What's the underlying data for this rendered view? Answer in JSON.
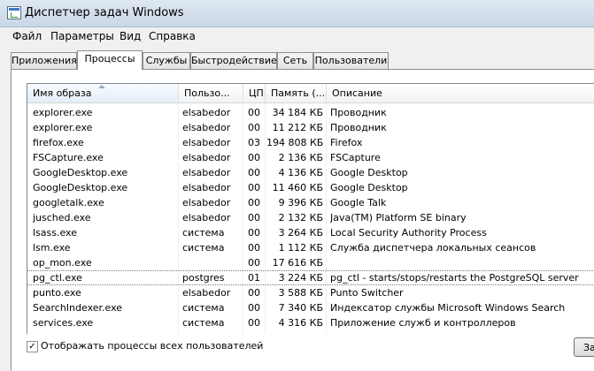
{
  "window": {
    "title": "Диспетчер задач Windows"
  },
  "menu": [
    "Файл",
    "Параметры",
    "Вид",
    "Справка"
  ],
  "tabs": [
    {
      "label": "Приложения",
      "active": false
    },
    {
      "label": "Процессы",
      "active": true
    },
    {
      "label": "Службы",
      "active": false
    },
    {
      "label": "Быстродействие",
      "active": false
    },
    {
      "label": "Сеть",
      "active": false
    },
    {
      "label": "Пользователи",
      "active": false
    }
  ],
  "columns": {
    "name": "Имя образа",
    "user": "Пользо...",
    "cpu": "ЦП",
    "mem": "Память (...",
    "desc": "Описание"
  },
  "processes": [
    {
      "name": "explorer.exe",
      "user": "elsabedor",
      "cpu": "00",
      "mem": "34 184 КБ",
      "desc": "Проводник"
    },
    {
      "name": "explorer.exe",
      "user": "elsabedor",
      "cpu": "00",
      "mem": "11 212 КБ",
      "desc": "Проводник"
    },
    {
      "name": "firefox.exe",
      "user": "elsabedor",
      "cpu": "03",
      "mem": "194 808 КБ",
      "desc": "Firefox"
    },
    {
      "name": "FSCapture.exe",
      "user": "elsabedor",
      "cpu": "00",
      "mem": "2 136 КБ",
      "desc": "FSCapture"
    },
    {
      "name": "GoogleDesktop.exe",
      "user": "elsabedor",
      "cpu": "00",
      "mem": "4 136 КБ",
      "desc": "Google Desktop"
    },
    {
      "name": "GoogleDesktop.exe",
      "user": "elsabedor",
      "cpu": "00",
      "mem": "11 460 КБ",
      "desc": "Google Desktop"
    },
    {
      "name": "googletalk.exe",
      "user": "elsabedor",
      "cpu": "00",
      "mem": "9 396 КБ",
      "desc": "Google Talk"
    },
    {
      "name": "jusched.exe",
      "user": "elsabedor",
      "cpu": "00",
      "mem": "2 132 КБ",
      "desc": "Java(TM) Platform SE binary"
    },
    {
      "name": "lsass.exe",
      "user": "система",
      "cpu": "00",
      "mem": "3 264 КБ",
      "desc": "Local Security Authority Process"
    },
    {
      "name": "lsm.exe",
      "user": "система",
      "cpu": "00",
      "mem": "1 112 КБ",
      "desc": "Служба диспетчера локальных сеансов"
    },
    {
      "name": "op_mon.exe",
      "user": "",
      "cpu": "00",
      "mem": "17 616 КБ",
      "desc": ""
    },
    {
      "name": "pg_ctl.exe",
      "user": "postgres",
      "cpu": "01",
      "mem": "3 224 КБ",
      "desc": "pg_ctl - starts/stops/restarts the PostgreSQL server",
      "selected": true
    },
    {
      "name": "punto.exe",
      "user": "elsabedor",
      "cpu": "00",
      "mem": "3 588 КБ",
      "desc": "Punto Switcher"
    },
    {
      "name": "SearchIndexer.exe",
      "user": "система",
      "cpu": "00",
      "mem": "7 340 КБ",
      "desc": "Индексатор службы Microsoft Windows Search"
    },
    {
      "name": "services.exe",
      "user": "система",
      "cpu": "00",
      "mem": "4 316 КБ",
      "desc": "Приложение служб и контроллеров"
    }
  ],
  "show_all_users": {
    "label": "Отображать процессы всех пользователей",
    "checked": true,
    "mark": "✓"
  },
  "end_button": {
    "label": "За"
  }
}
